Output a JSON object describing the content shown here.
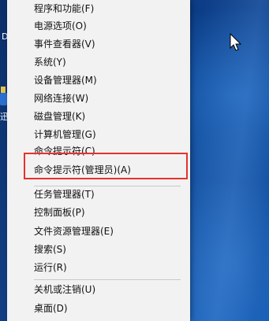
{
  "desktop": {
    "left_label_1": "D",
    "left_label_2": "迅"
  },
  "menu": {
    "items": [
      {
        "label": "程序和功能(F)"
      },
      {
        "label": "电源选项(O)"
      },
      {
        "label": "事件查看器(V)"
      },
      {
        "label": "系统(Y)"
      },
      {
        "label": "设备管理器(M)"
      },
      {
        "label": "网络连接(W)"
      },
      {
        "label": "磁盘管理(K)"
      },
      {
        "label": "计算机管理(G)"
      },
      {
        "label": "命令提示符(C)"
      },
      {
        "label": "命令提示符(管理员)(A)"
      },
      {
        "label": "任务管理器(T)"
      },
      {
        "label": "控制面板(P)"
      },
      {
        "label": "文件资源管理器(E)"
      },
      {
        "label": "搜索(S)"
      },
      {
        "label": "运行(R)"
      },
      {
        "label": "关机或注销(U)"
      },
      {
        "label": "桌面(D)"
      }
    ]
  },
  "colors": {
    "menu_bg": "#f2f2f2",
    "highlight_border": "#e5322d",
    "desktop_blue": "#0d4796"
  }
}
